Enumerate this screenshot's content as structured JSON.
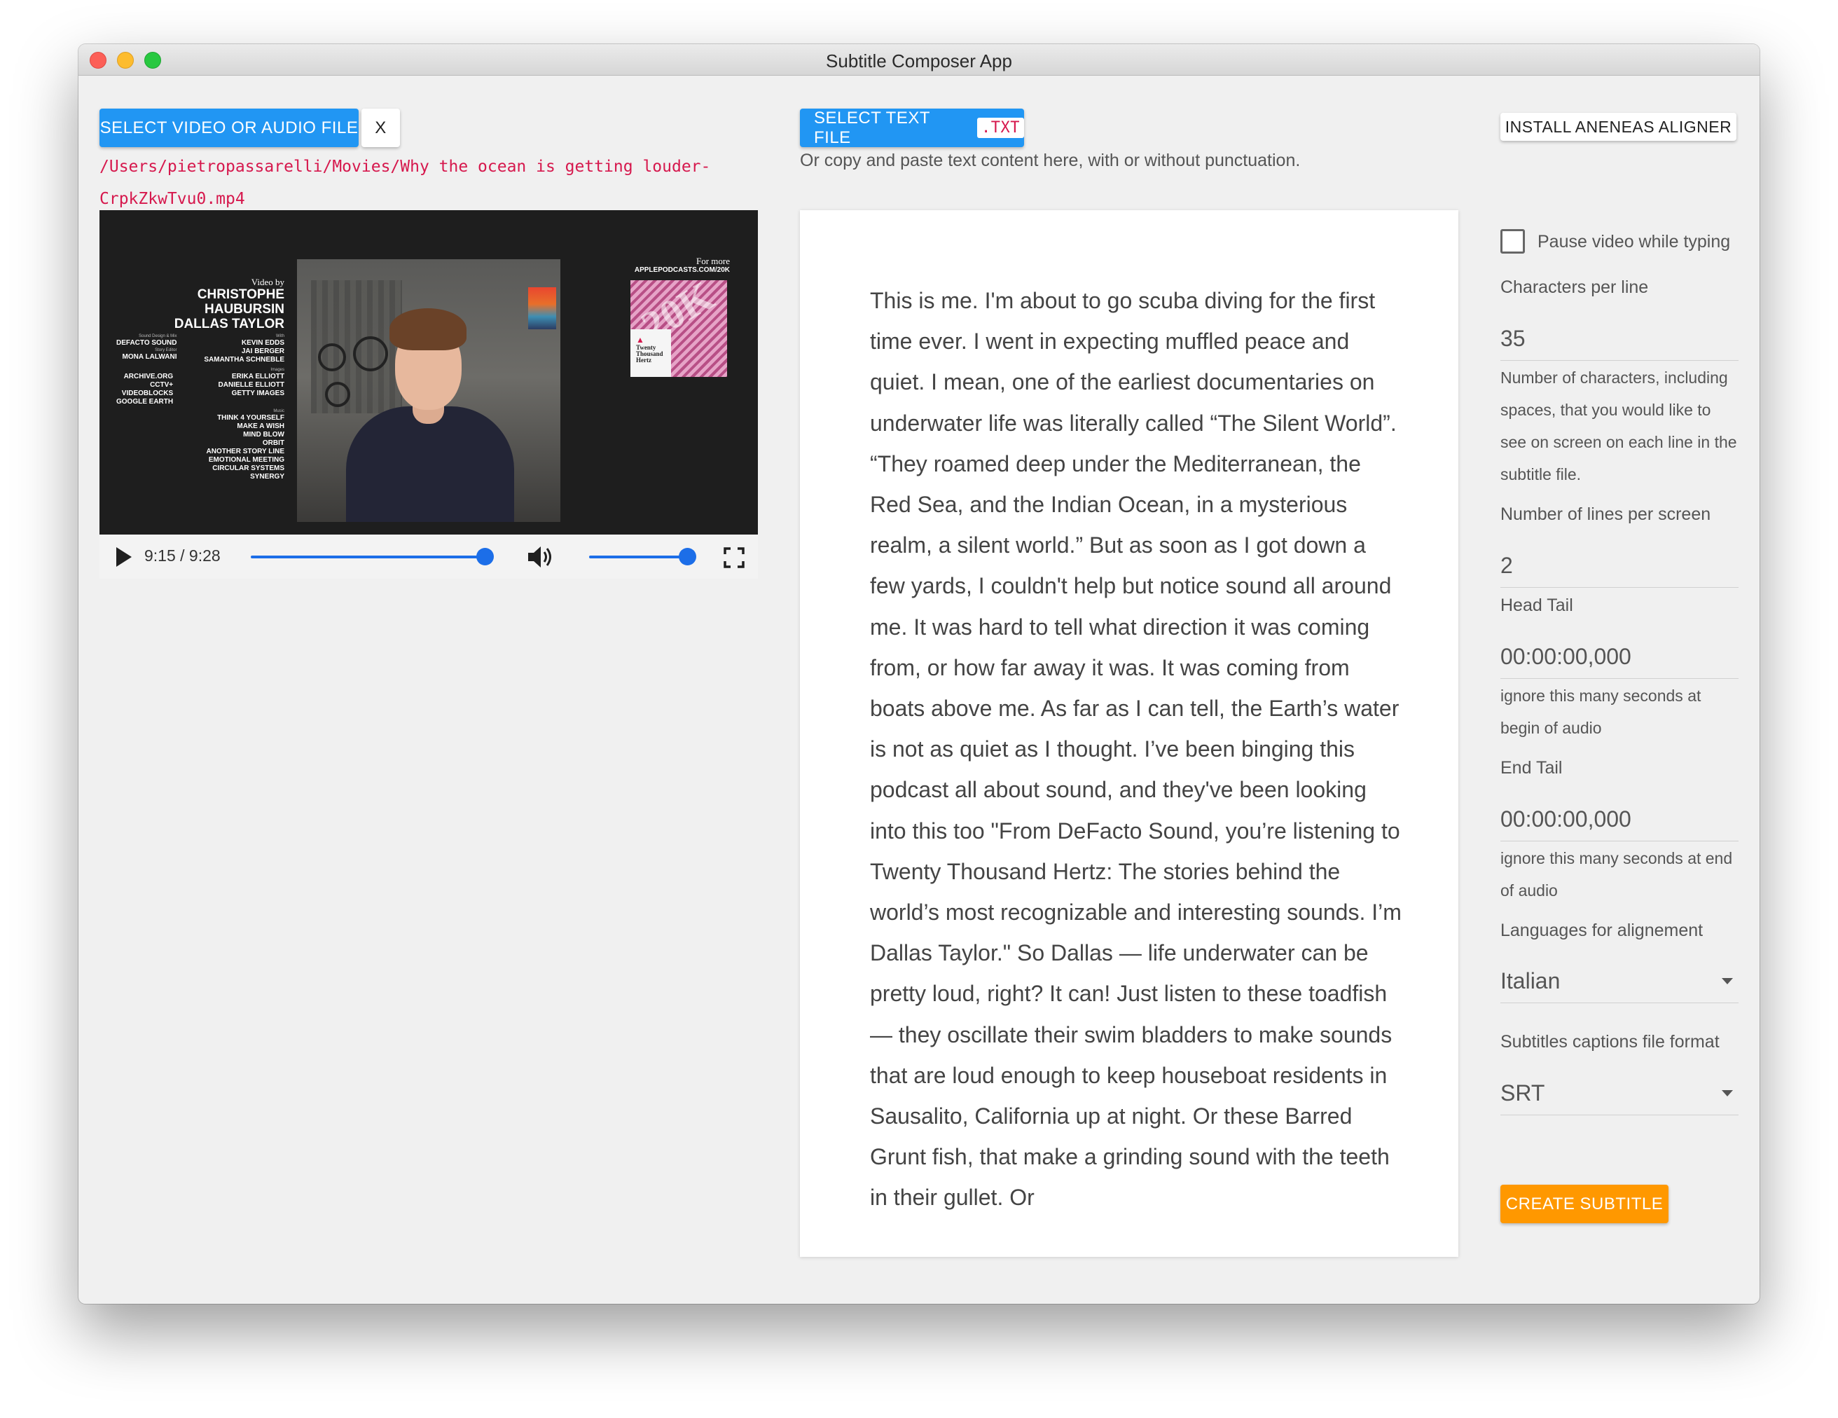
{
  "window": {
    "title": "Subtitle Composer App"
  },
  "media": {
    "select_button": "SELECT VIDEO OR AUDIO FILE",
    "clear_button": "X",
    "file_path": "/Users/pietropassarelli/Movies/Why the ocean is getting louder-CrpkZkwTvu0.mp4",
    "video_frame": {
      "credit_lines": {
        "video_by_label": "Video by",
        "name_1": "CHRISTOPHE HAUBURSIN",
        "name_2": "DALLAS TAYLOR",
        "sound_label": "Sound Design & Mix",
        "sound_value": "DEFACTO SOUND",
        "editor_label": "Story Editor",
        "editor_value": "MONA LALWANI",
        "with_label": "With",
        "with_1": "KEVIN EDDS",
        "with_2": "JAI BERGER",
        "with_3": "SAMANTHA SCHNEBLE",
        "archive_1": "ARCHIVE.ORG",
        "archive_2": "CCTV+",
        "archive_3": "VIDEOBLOCKS",
        "archive_4": "GOOGLE EARTH",
        "images_label": "Images",
        "images_1": "ERIKA ELLIOTT",
        "images_2": "DANIELLE ELLIOTT",
        "images_3": "GETTY IMAGES",
        "music_label": "Music",
        "music_1": "THINK 4 YOURSELF",
        "music_2": "MAKE A WISH",
        "music_3": "MIND BLOW",
        "music_4": "ORBIT",
        "music_5": "ANOTHER STORY LINE",
        "music_6": "EMOTIONAL MEETING",
        "music_7": "CIRCULAR SYSTEMS",
        "music_8": "SYNERGY"
      },
      "promo_label": "For more",
      "promo_url": "APPLEPODCASTS.COM/20K",
      "art_big": "20K",
      "art_name": "Twenty Thousand Hertz"
    },
    "player": {
      "time": "9:15 / 9:28",
      "progress_fraction": 0.977,
      "volume_fraction": 1.0,
      "play_icon": "play-icon",
      "volume_icon": "volume-icon",
      "fullscreen_icon": "fullscreen-icon"
    }
  },
  "text": {
    "select_button": "SELECT TEXT FILE",
    "ext_badge": ".TXT",
    "hint": "Or copy and paste text content here, with or without punctuation.",
    "content": "This is me. I'm about to go scuba diving for the first time ever. I went in expecting muffled peace and quiet. I mean, one of the earliest documentaries on underwater life was literally called “The Silent World”. “They roamed deep under the Mediterranean, the Red Sea, and the Indian Ocean, in a mysterious realm, a silent world.” But as soon as I got down a few yards, I couldn't help but notice sound all around me. It was hard to tell what direction it was coming from, or how far away it was. It was coming from boats above me. As far as I can tell, the Earth’s water is not as quiet as I thought. I’ve been binging this podcast all about sound, and they've been looking into this too \"From DeFacto Sound, you’re listening to Twenty Thousand Hertz: The stories behind the world’s most recognizable and interesting sounds. I’m Dallas Taylor.\" So Dallas — life underwater can be pretty loud, right? It can! Just listen to these toadfish— they oscillate their swim bladders to make sounds that are loud enough to keep houseboat residents in Sausalito, California up at night. Or these Barred Grunt fish, that make a grinding sound with the teeth in their gullet. Or"
  },
  "settings": {
    "install_button": "INSTALL ANENEAS ALIGNER",
    "pause_label": "Pause video while typing",
    "pause_checked": false,
    "chars_label": "Characters per line",
    "chars_value": "35",
    "chars_help": "Number of characters, including spaces, that you would like to see on screen on each line in the subtitle file.",
    "lines_label": "Number of lines per screen",
    "lines_value": "2",
    "head_label": "Head Tail",
    "head_value": "00:00:00,000",
    "head_help": "ignore this many seconds at begin of audio",
    "end_label": "End Tail",
    "end_value": "00:00:00,000",
    "end_help": "ignore this many seconds at end of audio",
    "lang_label": "Languages for alignement",
    "lang_value": "Italian",
    "format_label": "Subtitles captions file format",
    "format_value": "SRT",
    "create_button": "CREATE SUBTITLE"
  },
  "colors": {
    "accent_blue": "#2196f3",
    "accent_orange": "#ff9800",
    "path_red": "#d6184d",
    "slider_blue": "#1c6ee8"
  }
}
